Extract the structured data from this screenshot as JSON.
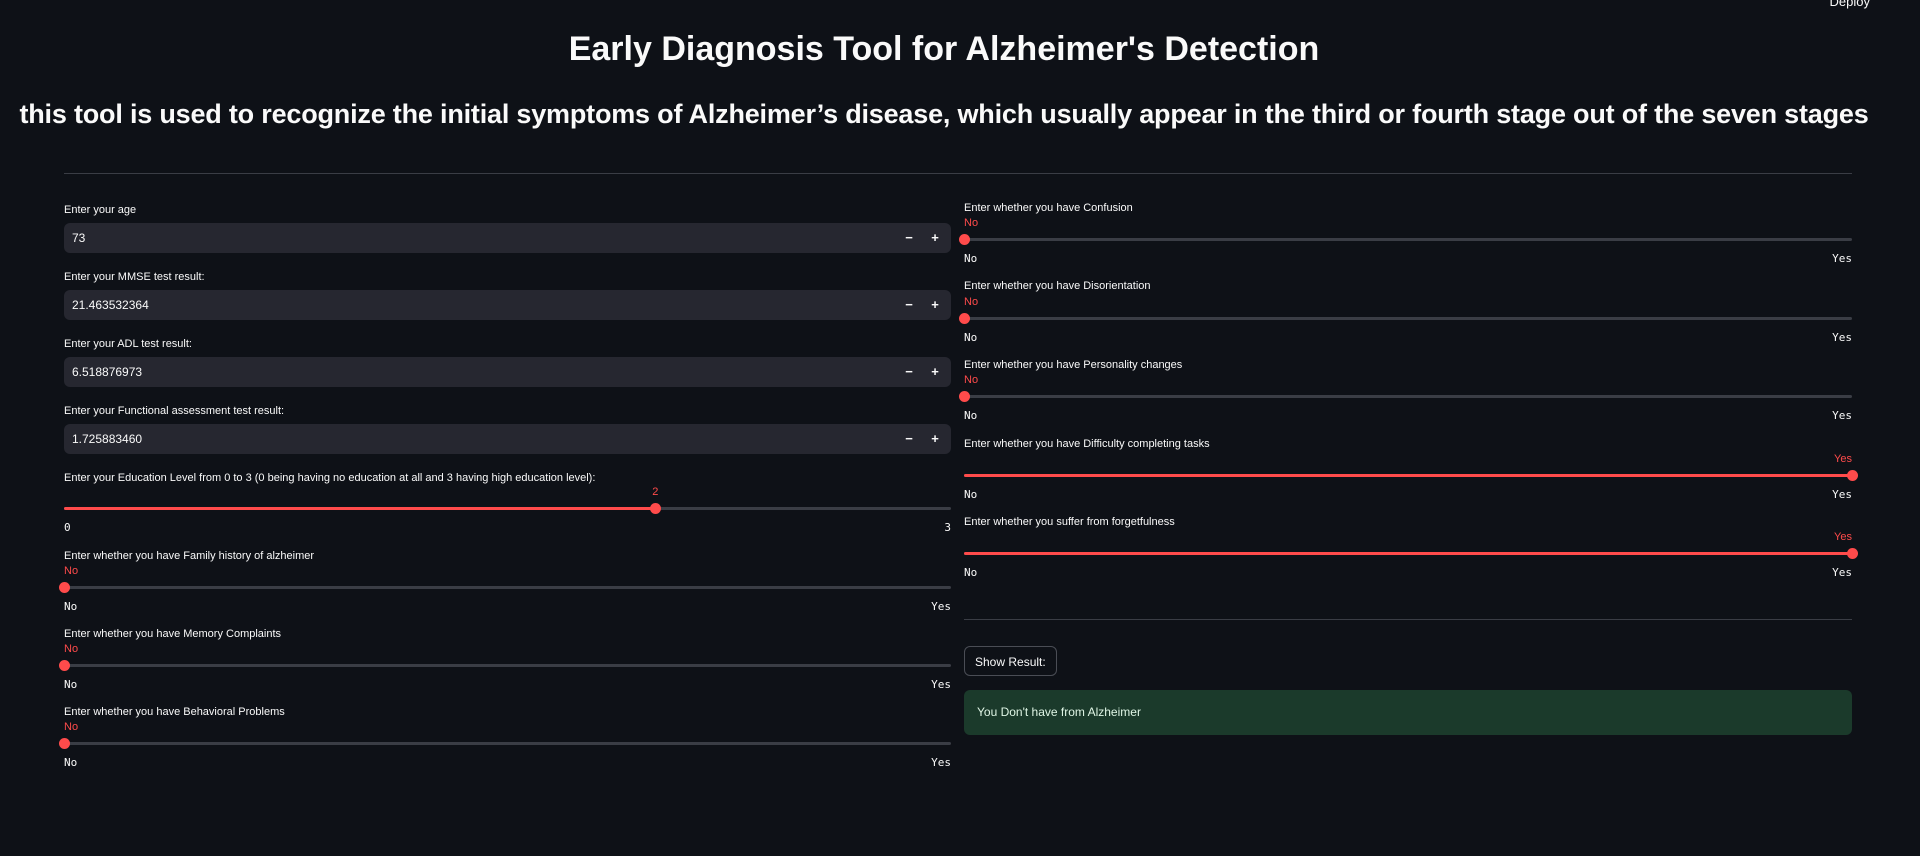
{
  "header": {
    "deploy_label": "Deploy",
    "title": "Early Diagnosis Tool for Alzheimer's Detection",
    "subtitle": "this tool is used to recognize the initial symptoms of Alzheimer’s disease, which usually appear in the third or fourth stage out of the seven stages"
  },
  "number_inputs": [
    {
      "label": "Enter your age",
      "value": "73",
      "minus": "−",
      "plus": "+"
    },
    {
      "label": "Enter your MMSE test result:",
      "value": "21.463532364",
      "minus": "−",
      "plus": "+"
    },
    {
      "label": "Enter your ADL test result:",
      "value": "6.518876973",
      "minus": "−",
      "plus": "+"
    },
    {
      "label": "Enter your Functional assessment test result:",
      "value": "1.725883460",
      "minus": "−",
      "plus": "+"
    }
  ],
  "education_slider": {
    "label": "Enter your Education Level from 0 to 3 (0 being having no education at all and 3 having high education level):",
    "value": "2",
    "min": "0",
    "max": "3",
    "fraction": 0.6667
  },
  "left_sliders": [
    {
      "label": "Enter whether you have Family history of alzheimer",
      "value": "No",
      "min": "No",
      "max": "Yes",
      "fraction": 0
    },
    {
      "label": "Enter whether you have Memory Complaints",
      "value": "No",
      "min": "No",
      "max": "Yes",
      "fraction": 0
    },
    {
      "label": "Enter whether you have Behavioral Problems",
      "value": "No",
      "min": "No",
      "max": "Yes",
      "fraction": 0
    }
  ],
  "right_sliders": [
    {
      "label": "Enter whether you have Confusion",
      "value": "No",
      "min": "No",
      "max": "Yes",
      "fraction": 0
    },
    {
      "label": "Enter whether you have Disorientation",
      "value": "No",
      "min": "No",
      "max": "Yes",
      "fraction": 0
    },
    {
      "label": "Enter whether you have Personality changes",
      "value": "No",
      "min": "No",
      "max": "Yes",
      "fraction": 0
    },
    {
      "label": "Enter whether you have Difficulty completing tasks",
      "value": "Yes",
      "min": "No",
      "max": "Yes",
      "fraction": 1
    },
    {
      "label": "Enter whether you suffer from forgetfulness",
      "value": "Yes",
      "min": "No",
      "max": "Yes",
      "fraction": 1
    }
  ],
  "action": {
    "button_label": "Show Result:",
    "result_text": "You Don't have from Alzheimer"
  },
  "colors": {
    "background": "#0e1117",
    "accent": "#ff4b4b",
    "input_bg": "#262730",
    "success_bg": "#1b3a2b"
  }
}
